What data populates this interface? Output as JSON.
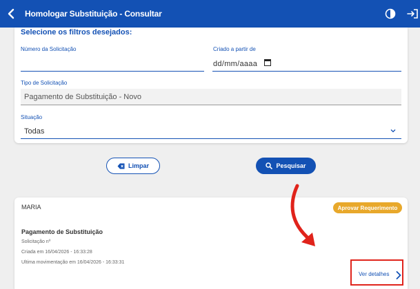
{
  "header": {
    "title": "Homologar Substituição - Consultar",
    "back_icon": "chevron-left-icon",
    "contrast_icon": "contrast-icon",
    "logout_icon": "logout-icon"
  },
  "filters": {
    "title": "Selecione os filtros desejados:",
    "numero": {
      "label": "Número da Solicitação",
      "value": ""
    },
    "criado": {
      "label": "Criado a partir de",
      "value": "dd/mm/aaaa"
    },
    "tipo": {
      "label": "Tipo de Solicitação",
      "value": "Pagamento de Substituição - Novo"
    },
    "situacao": {
      "label": "Situação",
      "value": "Todas"
    }
  },
  "actions": {
    "limpar_label": "Limpar",
    "pesquisar_label": "Pesquisar"
  },
  "result": {
    "name": "MARIA",
    "badge": "Aprovar Requerimento",
    "type": "Pagamento de Substituição",
    "solicitacao": "Solicitação nº",
    "criada": "Criada em 16/04/2026 - 16:33:28",
    "ultima": "Ultima movimentação em 16/04/2026 - 16:33:31",
    "details_link": "Ver detalhes"
  },
  "colors": {
    "primary": "#1351b4",
    "badge": "#e8a82b",
    "annotation": "#e0231b"
  }
}
